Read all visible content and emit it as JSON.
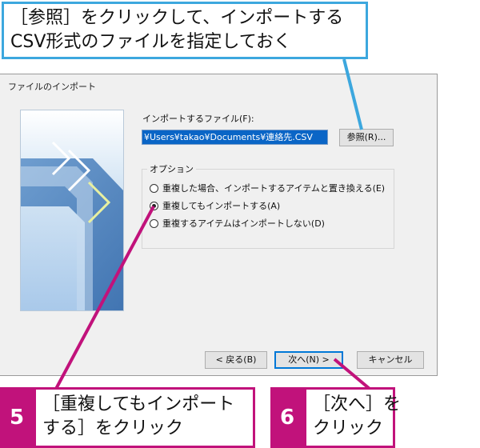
{
  "annotations": {
    "top": {
      "line1": "［参照］をクリックして、インポートする",
      "line2": "CSV形式のファイルを指定しておく"
    },
    "step5": {
      "number": "5",
      "line1": "［重複してもインポート",
      "line2": "する］をクリック"
    },
    "step6": {
      "number": "6",
      "line1": "［次へ］を",
      "line2": "クリック"
    }
  },
  "dialog": {
    "title": "ファイルのインポート",
    "file_label": "インポートするファイル(F):",
    "file_value": "¥Users¥takao¥Documents¥連絡先.CSV",
    "browse_label": "参照(R)...",
    "options_legend": "オプション",
    "options": [
      {
        "label": "重複した場合、インポートするアイテムと置き換える(E)",
        "checked": false
      },
      {
        "label": "重複してもインポートする(A)",
        "checked": true
      },
      {
        "label": "重複するアイテムはインポートしない(D)",
        "checked": false
      }
    ],
    "buttons": {
      "back": "< 戻る(B)",
      "next": "次へ(N) >",
      "cancel": "キャンセル"
    }
  },
  "colors": {
    "callout_blue": "#3ca7de",
    "step_magenta": "#c1127b",
    "selection_blue": "#0a65c6"
  }
}
